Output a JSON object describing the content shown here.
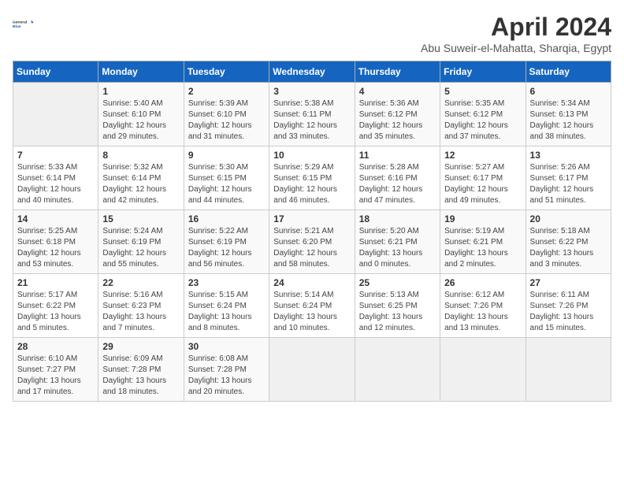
{
  "header": {
    "logo_text_general": "General",
    "logo_text_blue": "Blue",
    "month": "April 2024",
    "location": "Abu Suweir-el-Mahatta, Sharqia, Egypt"
  },
  "weekdays": [
    "Sunday",
    "Monday",
    "Tuesday",
    "Wednesday",
    "Thursday",
    "Friday",
    "Saturday"
  ],
  "weeks": [
    [
      {
        "day": "",
        "sunrise": "",
        "sunset": "",
        "daylight": ""
      },
      {
        "day": "1",
        "sunrise": "Sunrise: 5:40 AM",
        "sunset": "Sunset: 6:10 PM",
        "daylight": "Daylight: 12 hours and 29 minutes."
      },
      {
        "day": "2",
        "sunrise": "Sunrise: 5:39 AM",
        "sunset": "Sunset: 6:10 PM",
        "daylight": "Daylight: 12 hours and 31 minutes."
      },
      {
        "day": "3",
        "sunrise": "Sunrise: 5:38 AM",
        "sunset": "Sunset: 6:11 PM",
        "daylight": "Daylight: 12 hours and 33 minutes."
      },
      {
        "day": "4",
        "sunrise": "Sunrise: 5:36 AM",
        "sunset": "Sunset: 6:12 PM",
        "daylight": "Daylight: 12 hours and 35 minutes."
      },
      {
        "day": "5",
        "sunrise": "Sunrise: 5:35 AM",
        "sunset": "Sunset: 6:12 PM",
        "daylight": "Daylight: 12 hours and 37 minutes."
      },
      {
        "day": "6",
        "sunrise": "Sunrise: 5:34 AM",
        "sunset": "Sunset: 6:13 PM",
        "daylight": "Daylight: 12 hours and 38 minutes."
      }
    ],
    [
      {
        "day": "7",
        "sunrise": "Sunrise: 5:33 AM",
        "sunset": "Sunset: 6:14 PM",
        "daylight": "Daylight: 12 hours and 40 minutes."
      },
      {
        "day": "8",
        "sunrise": "Sunrise: 5:32 AM",
        "sunset": "Sunset: 6:14 PM",
        "daylight": "Daylight: 12 hours and 42 minutes."
      },
      {
        "day": "9",
        "sunrise": "Sunrise: 5:30 AM",
        "sunset": "Sunset: 6:15 PM",
        "daylight": "Daylight: 12 hours and 44 minutes."
      },
      {
        "day": "10",
        "sunrise": "Sunrise: 5:29 AM",
        "sunset": "Sunset: 6:15 PM",
        "daylight": "Daylight: 12 hours and 46 minutes."
      },
      {
        "day": "11",
        "sunrise": "Sunrise: 5:28 AM",
        "sunset": "Sunset: 6:16 PM",
        "daylight": "Daylight: 12 hours and 47 minutes."
      },
      {
        "day": "12",
        "sunrise": "Sunrise: 5:27 AM",
        "sunset": "Sunset: 6:17 PM",
        "daylight": "Daylight: 12 hours and 49 minutes."
      },
      {
        "day": "13",
        "sunrise": "Sunrise: 5:26 AM",
        "sunset": "Sunset: 6:17 PM",
        "daylight": "Daylight: 12 hours and 51 minutes."
      }
    ],
    [
      {
        "day": "14",
        "sunrise": "Sunrise: 5:25 AM",
        "sunset": "Sunset: 6:18 PM",
        "daylight": "Daylight: 12 hours and 53 minutes."
      },
      {
        "day": "15",
        "sunrise": "Sunrise: 5:24 AM",
        "sunset": "Sunset: 6:19 PM",
        "daylight": "Daylight: 12 hours and 55 minutes."
      },
      {
        "day": "16",
        "sunrise": "Sunrise: 5:22 AM",
        "sunset": "Sunset: 6:19 PM",
        "daylight": "Daylight: 12 hours and 56 minutes."
      },
      {
        "day": "17",
        "sunrise": "Sunrise: 5:21 AM",
        "sunset": "Sunset: 6:20 PM",
        "daylight": "Daylight: 12 hours and 58 minutes."
      },
      {
        "day": "18",
        "sunrise": "Sunrise: 5:20 AM",
        "sunset": "Sunset: 6:21 PM",
        "daylight": "Daylight: 13 hours and 0 minutes."
      },
      {
        "day": "19",
        "sunrise": "Sunrise: 5:19 AM",
        "sunset": "Sunset: 6:21 PM",
        "daylight": "Daylight: 13 hours and 2 minutes."
      },
      {
        "day": "20",
        "sunrise": "Sunrise: 5:18 AM",
        "sunset": "Sunset: 6:22 PM",
        "daylight": "Daylight: 13 hours and 3 minutes."
      }
    ],
    [
      {
        "day": "21",
        "sunrise": "Sunrise: 5:17 AM",
        "sunset": "Sunset: 6:22 PM",
        "daylight": "Daylight: 13 hours and 5 minutes."
      },
      {
        "day": "22",
        "sunrise": "Sunrise: 5:16 AM",
        "sunset": "Sunset: 6:23 PM",
        "daylight": "Daylight: 13 hours and 7 minutes."
      },
      {
        "day": "23",
        "sunrise": "Sunrise: 5:15 AM",
        "sunset": "Sunset: 6:24 PM",
        "daylight": "Daylight: 13 hours and 8 minutes."
      },
      {
        "day": "24",
        "sunrise": "Sunrise: 5:14 AM",
        "sunset": "Sunset: 6:24 PM",
        "daylight": "Daylight: 13 hours and 10 minutes."
      },
      {
        "day": "25",
        "sunrise": "Sunrise: 5:13 AM",
        "sunset": "Sunset: 6:25 PM",
        "daylight": "Daylight: 13 hours and 12 minutes."
      },
      {
        "day": "26",
        "sunrise": "Sunrise: 6:12 AM",
        "sunset": "Sunset: 7:26 PM",
        "daylight": "Daylight: 13 hours and 13 minutes."
      },
      {
        "day": "27",
        "sunrise": "Sunrise: 6:11 AM",
        "sunset": "Sunset: 7:26 PM",
        "daylight": "Daylight: 13 hours and 15 minutes."
      }
    ],
    [
      {
        "day": "28",
        "sunrise": "Sunrise: 6:10 AM",
        "sunset": "Sunset: 7:27 PM",
        "daylight": "Daylight: 13 hours and 17 minutes."
      },
      {
        "day": "29",
        "sunrise": "Sunrise: 6:09 AM",
        "sunset": "Sunset: 7:28 PM",
        "daylight": "Daylight: 13 hours and 18 minutes."
      },
      {
        "day": "30",
        "sunrise": "Sunrise: 6:08 AM",
        "sunset": "Sunset: 7:28 PM",
        "daylight": "Daylight: 13 hours and 20 minutes."
      },
      {
        "day": "",
        "sunrise": "",
        "sunset": "",
        "daylight": ""
      },
      {
        "day": "",
        "sunrise": "",
        "sunset": "",
        "daylight": ""
      },
      {
        "day": "",
        "sunrise": "",
        "sunset": "",
        "daylight": ""
      },
      {
        "day": "",
        "sunrise": "",
        "sunset": "",
        "daylight": ""
      }
    ]
  ]
}
